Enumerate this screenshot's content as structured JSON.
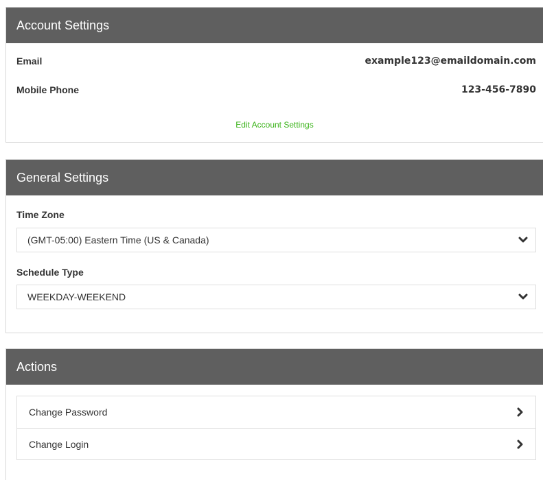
{
  "account": {
    "title": "Account Settings",
    "email_label": "Email",
    "email_value": "example123@emaildomain.com",
    "phone_label": "Mobile Phone",
    "phone_value": "123-456-7890",
    "edit_link": "Edit Account Settings"
  },
  "general": {
    "title": "General Settings",
    "timezone_label": "Time Zone",
    "timezone_value": "(GMT-05:00) Eastern Time (US & Canada)",
    "schedule_label": "Schedule Type",
    "schedule_value": "WEEKDAY-WEEKEND"
  },
  "actions": {
    "title": "Actions",
    "items": [
      {
        "label": "Change Password",
        "icon": "chevron-right-icon"
      },
      {
        "label": "Change Login",
        "icon": "chevron-right-icon"
      }
    ]
  },
  "colors": {
    "header_bg": "#5f5f5f",
    "link": "#3bb31a"
  }
}
